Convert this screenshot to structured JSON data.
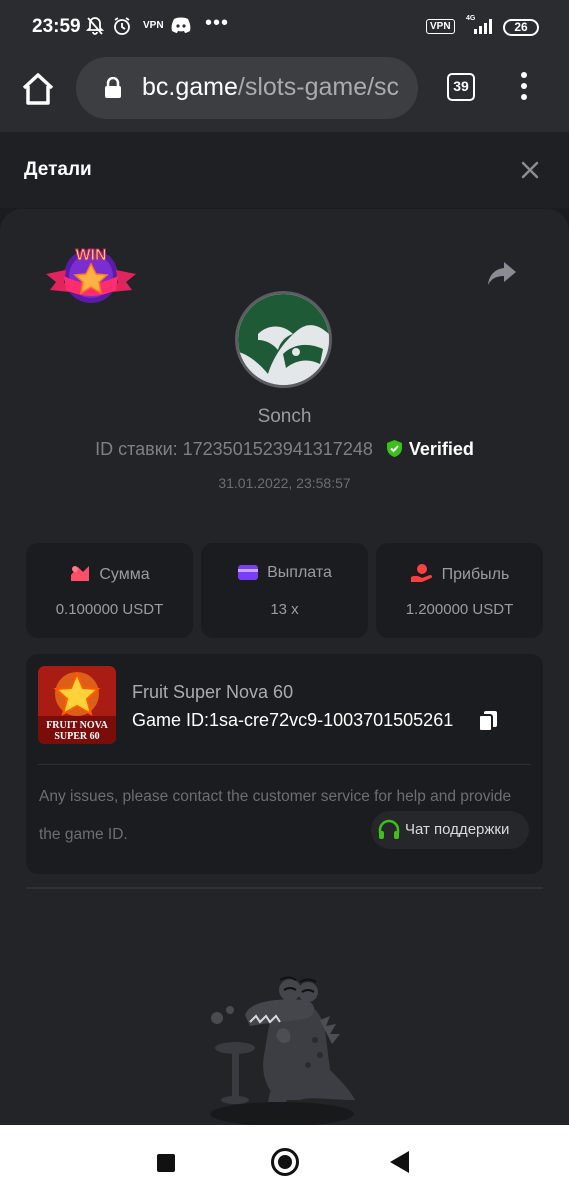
{
  "status_bar": {
    "time": "23:59",
    "vpn_small": "VPN",
    "dots": "•••",
    "vpn_box": "VPN",
    "network": "4G",
    "battery": "26"
  },
  "browser": {
    "url_domain": "bc.game",
    "url_path": "/slots-game/sc",
    "tab_count": "39"
  },
  "header": {
    "title": "Детали"
  },
  "bet": {
    "username": "Sonch",
    "bet_id_label": "ID ставки:",
    "bet_id": "1723501523941317248",
    "verified": "Verified",
    "datetime": "31.01.2022, 23:58:57"
  },
  "stats": [
    {
      "label": "Сумма",
      "value": "0.100000 USDT",
      "icon": "amount-icon",
      "color": "#ff4d6a"
    },
    {
      "label": "Выплата",
      "value": "13 x",
      "icon": "wallet-icon",
      "color": "#7b3df5"
    },
    {
      "label": "Прибыль",
      "value": "1.200000 USDT",
      "icon": "profit-icon",
      "color": "#ff4040"
    }
  ],
  "game": {
    "name": "Fruit Super Nova 60",
    "id_label": "Game ID:",
    "id_value": "1sa-cre72vc9-1003701505261",
    "thumb_text_1": "FRUIT NOVA",
    "thumb_text_2": "SUPER 60",
    "notice": "Any issues, please contact the customer service for help and provide the game ID.",
    "support_label": "Чат поддержки"
  },
  "badge": {
    "text": "WIN"
  },
  "colors": {
    "background": "#1b1c1f",
    "card": "#232427",
    "verified_green": "#3bc117",
    "support_green": "#3bc117"
  }
}
